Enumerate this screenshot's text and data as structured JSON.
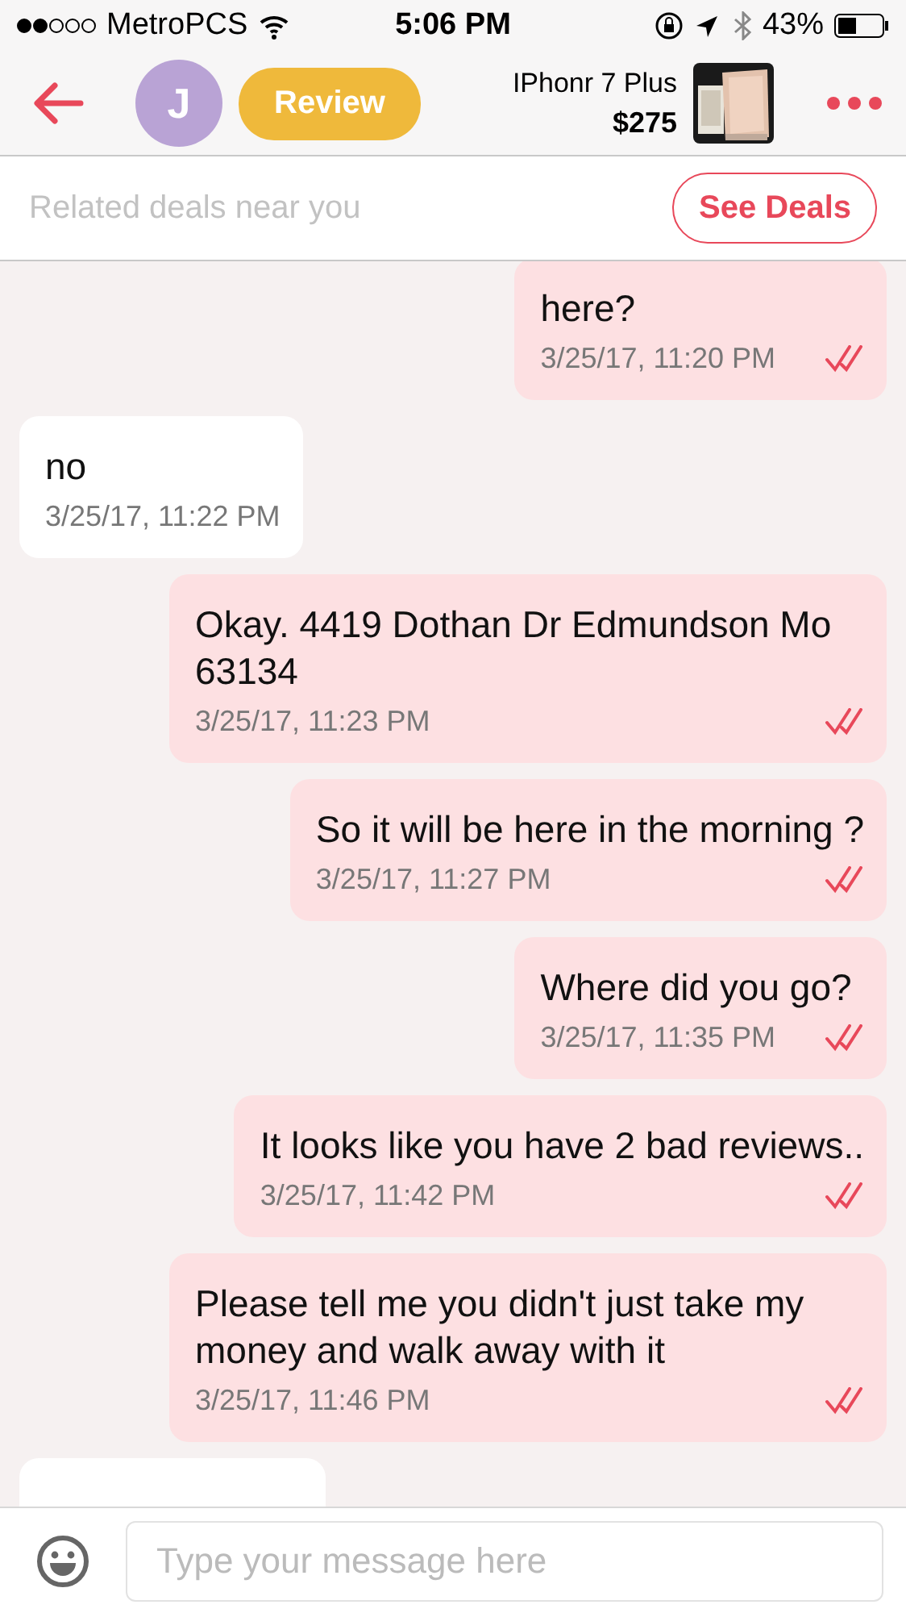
{
  "status_bar": {
    "carrier": "MetroPCS",
    "time": "5:06 PM",
    "battery": "43%"
  },
  "header": {
    "avatar_initial": "J",
    "review_label": "Review",
    "product_title": "IPhonr 7 Plus",
    "price": "$275"
  },
  "deals_banner": {
    "text": "Related deals near you",
    "button": "See Deals"
  },
  "messages": [
    {
      "kind": "sent",
      "text": "here?",
      "time": "3/25/17, 11:20 PM",
      "read": true
    },
    {
      "kind": "received",
      "text": "no",
      "time": "3/25/17, 11:22 PM"
    },
    {
      "kind": "sent",
      "text": "Okay. 4419 Dothan Dr Edmundson Mo 63134",
      "time": "3/25/17, 11:23 PM",
      "read": true
    },
    {
      "kind": "sent",
      "text": "So it will be here in the morning ?",
      "time": "3/25/17, 11:27 PM",
      "read": true
    },
    {
      "kind": "sent",
      "text": "Where did you go?",
      "time": "3/25/17, 11:35 PM",
      "read": true
    },
    {
      "kind": "sent",
      "text": "It looks like you have 2 bad reviews..",
      "time": "3/25/17, 11:42 PM",
      "read": true
    },
    {
      "kind": "sent",
      "text": "Please tell me you didn't just take my money and walk away with it",
      "time": "3/25/17, 11:46 PM",
      "read": true
    },
    {
      "kind": "received_cut"
    }
  ],
  "composer": {
    "placeholder": "Type your message here"
  }
}
